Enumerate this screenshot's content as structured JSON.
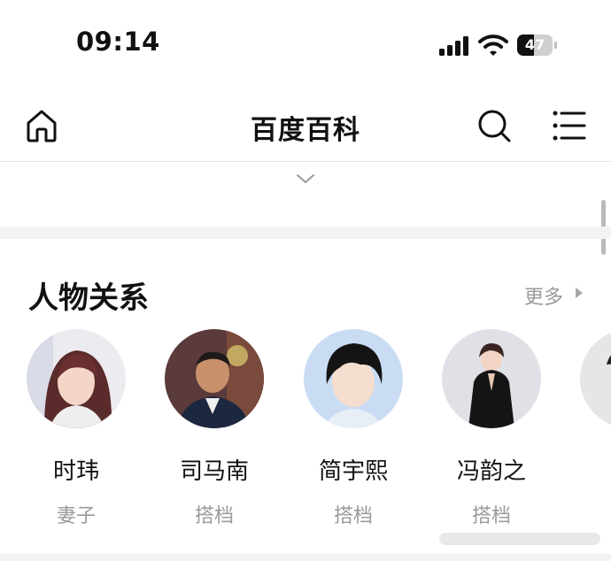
{
  "status_bar": {
    "time": "09:14",
    "battery_level": "47"
  },
  "header": {
    "title": "百度百科",
    "icons": [
      "home-icon",
      "search-icon",
      "menu-icon"
    ]
  },
  "section": {
    "title": "人物关系",
    "more_label": "更多",
    "people": [
      {
        "name": "时玮",
        "relation": "妻子"
      },
      {
        "name": "司马南",
        "relation": "搭档"
      },
      {
        "name": "简宇熙",
        "relation": "搭档"
      },
      {
        "name": "冯韵之",
        "relation": "搭档"
      },
      {
        "name": "",
        "relation": ""
      }
    ]
  },
  "colors": {
    "text": "#111111",
    "muted": "#999999",
    "divider": "#f2f3f5"
  }
}
